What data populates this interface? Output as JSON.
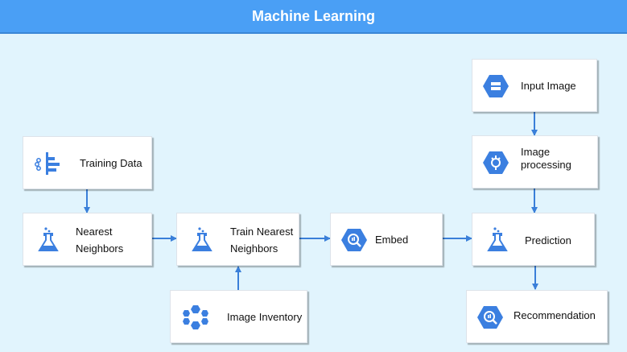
{
  "header": {
    "title": "Machine Learning"
  },
  "nodes": {
    "input_image": {
      "label": "Input Image",
      "icon": "storage-hexagon-icon"
    },
    "image_processing": {
      "label": "Image\nprocessing",
      "icon": "vision-hexagon-icon"
    },
    "training_data": {
      "label": "Training Data",
      "icon": "data-pipeline-icon"
    },
    "nearest_neighbors": {
      "label": "Nearest\nNeighbors",
      "icon": "lab-flask-icon"
    },
    "train_nearest_neighbors": {
      "label": "Train Nearest\nNeighbors",
      "icon": "lab-flask-icon"
    },
    "embed": {
      "label": "Embed",
      "icon": "query-hexagon-icon"
    },
    "prediction": {
      "label": "Prediction",
      "icon": "lab-flask-icon"
    },
    "image_inventory": {
      "label": "Image Inventory",
      "icon": "cluster-hexagons-icon"
    },
    "recommendation": {
      "label": "Recommendation",
      "icon": "query-hexagon-icon"
    }
  },
  "colors": {
    "header": "#4a9ff5",
    "background": "#e1f4fd",
    "accent": "#3b7fe0",
    "arrow": "#3a7fd9"
  }
}
